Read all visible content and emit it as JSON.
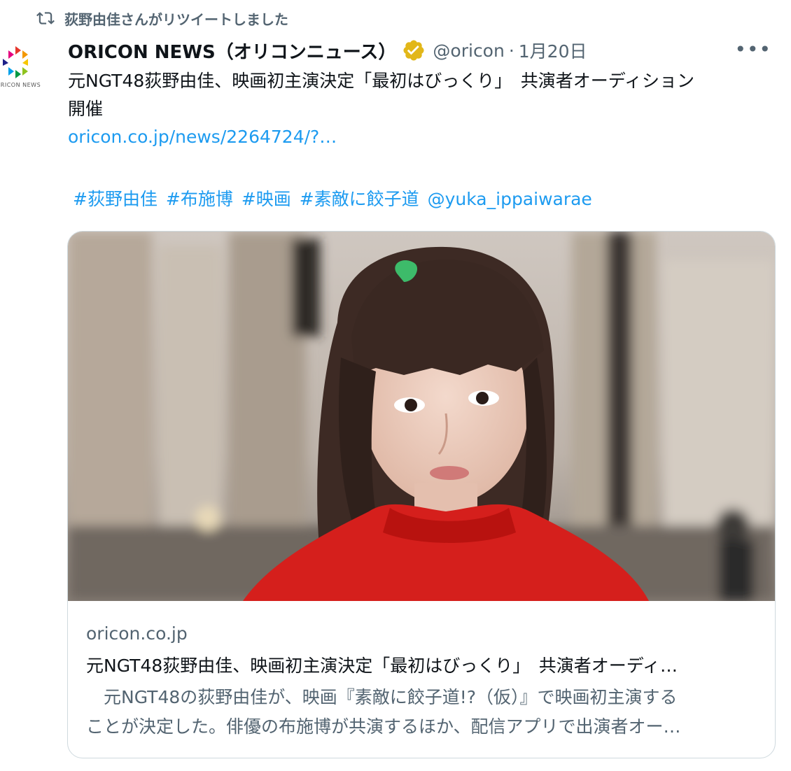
{
  "retweet": {
    "icon": "retweet-icon",
    "text": "荻野由佳さんがリツイートしました"
  },
  "author": {
    "avatar_icon": "oricon-news-logo",
    "avatar_text": "ORICON NEWS",
    "display_name": "ORICON NEWS（オリコンニュース）",
    "verified_icon": "verified-badge-icon",
    "handle": "@oricon",
    "separator": "·",
    "date": "1月20日",
    "more_label": "•••"
  },
  "tweet": {
    "line1": "元NGT48荻野由佳、映画初主演決定「最初はびっくり」　共演者オーディション",
    "line2": "開催",
    "link": "oricon.co.jp/news/2264724/?…",
    "hashtags": [
      "#荻野由佳",
      "#布施博",
      "#映画",
      "#素敵に餃子道"
    ],
    "mention": "@yuka_ippaiwarae"
  },
  "card": {
    "image_icon": "photo-woman-red-sweater",
    "domain": "oricon.co.jp",
    "title": "元NGT48荻野由佳、映画初主演決定「最初はびっくり」　共演者オーディ…",
    "desc_line1": "　元NGT48の荻野由佳が、映画『素敵に餃子道!?（仮）』で映画初主演する",
    "desc_line2": "ことが決定した。俳優の布施博が共演するほか、配信アプリで出演者オー…"
  },
  "colors": {
    "link": "#1d9bf0",
    "secondary": "#536471",
    "text": "#0f1419",
    "verified_gold": "#e2b719",
    "border": "#cfd9de"
  }
}
